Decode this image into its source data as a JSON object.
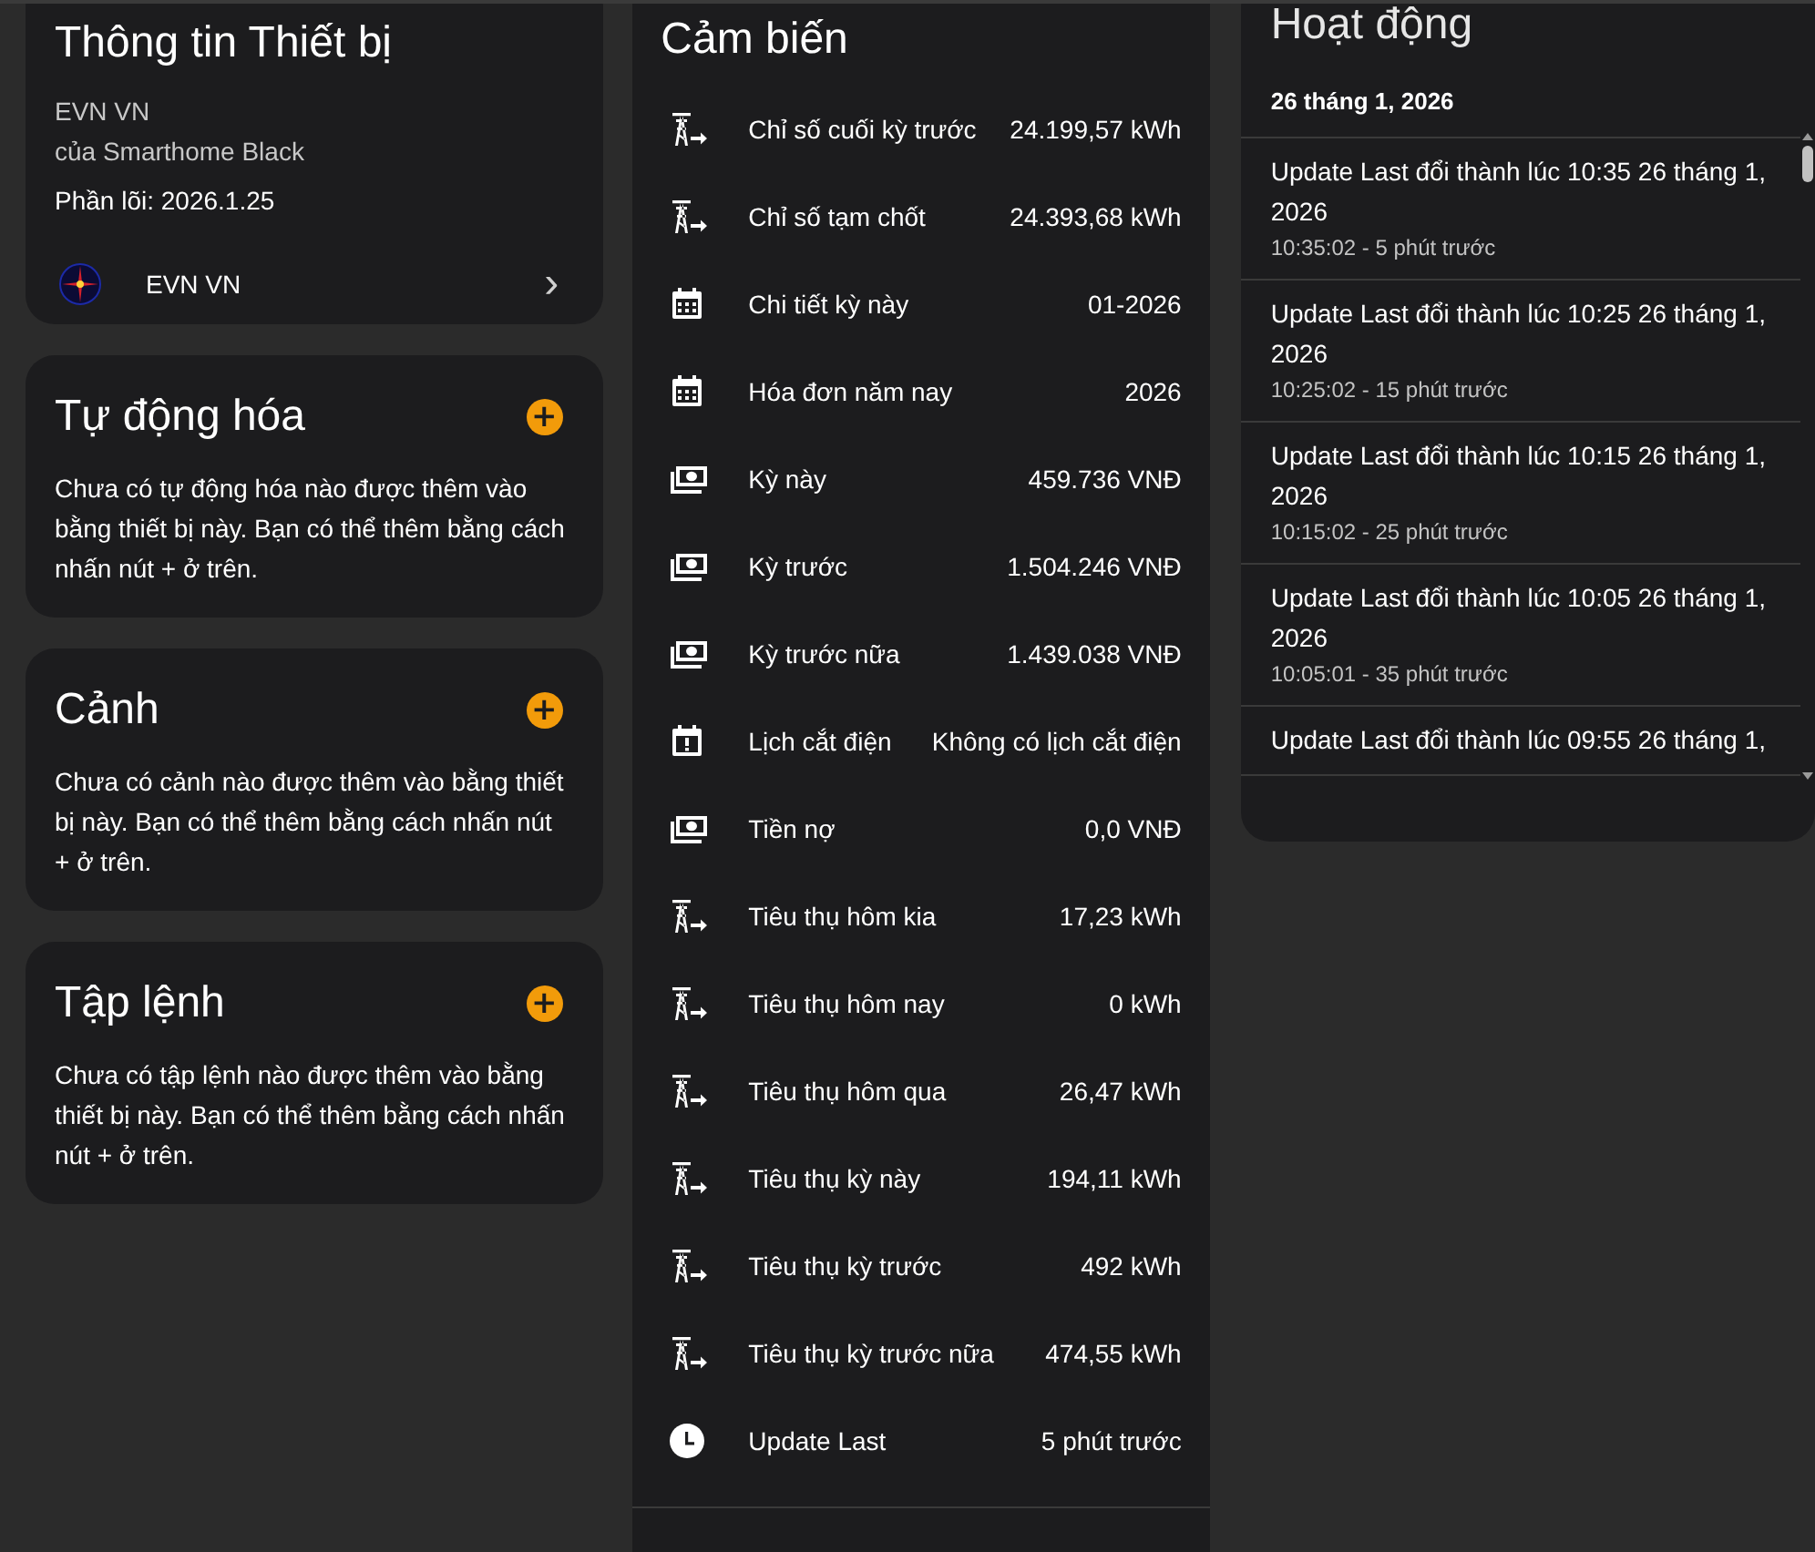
{
  "device_info": {
    "title": "Thông tin Thiết bị",
    "model": "EVN VN",
    "manufacturer": "của Smarthome Black",
    "firmware": "Phần lõi: 2026.1.25",
    "integration": {
      "name": "EVN VN",
      "chevron": "›"
    }
  },
  "sections": [
    {
      "title": "Tự động hóa",
      "add": "+",
      "empty_text": "Chưa có tự động hóa nào được thêm vào bằng thiết bị này. Bạn có thể thêm bằng cách nhấn nút + ở trên."
    },
    {
      "title": "Cảnh",
      "add": "+",
      "empty_text": "Chưa có cảnh nào được thêm vào bằng thiết bị này. Bạn có thể thêm bằng cách nhấn nút + ở trên."
    },
    {
      "title": "Tập lệnh",
      "add": "+",
      "empty_text": "Chưa có tập lệnh nào được thêm vào bằng thiết bị này. Bạn có thể thêm bằng cách nhấn nút + ở trên."
    }
  ],
  "sensors": {
    "title": "Cảm biến",
    "rows": [
      {
        "kind": "tower",
        "name": "Chỉ số cuối kỳ trước",
        "value": "24.199,57 kWh"
      },
      {
        "kind": "tower",
        "name": "Chỉ số tạm chốt",
        "value": "24.393,68 kWh"
      },
      {
        "kind": "calendar",
        "name": "Chi tiết kỳ này",
        "value": "01-2026"
      },
      {
        "kind": "calendar",
        "name": "Hóa đơn năm nay",
        "value": "2026"
      },
      {
        "kind": "cash",
        "name": "Kỳ này",
        "value": "459.736 VNĐ"
      },
      {
        "kind": "cash",
        "name": "Kỳ trước",
        "value": "1.504.246 VNĐ"
      },
      {
        "kind": "cash",
        "name": "Kỳ trước nữa",
        "value": "1.439.038 VNĐ"
      },
      {
        "kind": "alert",
        "name": "Lịch cắt điện",
        "value": "Không có lịch cắt điện"
      },
      {
        "kind": "cash",
        "name": "Tiền nợ",
        "value": "0,0 VNĐ"
      },
      {
        "kind": "tower",
        "name": "Tiêu thụ hôm kia",
        "value": "17,23 kWh"
      },
      {
        "kind": "tower",
        "name": "Tiêu thụ hôm nay",
        "value": "0 kWh"
      },
      {
        "kind": "tower",
        "name": "Tiêu thụ hôm qua",
        "value": "26,47 kWh"
      },
      {
        "kind": "tower",
        "name": "Tiêu thụ kỳ này",
        "value": "194,11 kWh"
      },
      {
        "kind": "tower",
        "name": "Tiêu thụ kỳ trước",
        "value": "492 kWh"
      },
      {
        "kind": "tower",
        "name": "Tiêu thụ kỳ trước nữa",
        "value": "474,55 kWh"
      },
      {
        "kind": "clock",
        "name": "Update Last",
        "value": "5 phút trước"
      }
    ]
  },
  "activity": {
    "title": "Hoạt động",
    "date": "26 tháng 1, 2026",
    "entries": [
      {
        "message": "Update Last đổi thành lúc 10:35 26 tháng 1, 2026",
        "time": "10:35:02 - 5 phút trước"
      },
      {
        "message": "Update Last đổi thành lúc 10:25 26 tháng 1, 2026",
        "time": "10:25:02 - 15 phút trước"
      },
      {
        "message": "Update Last đổi thành lúc 10:15 26 tháng 1, 2026",
        "time": "10:15:02 - 25 phút trước"
      },
      {
        "message": "Update Last đổi thành lúc 10:05 26 tháng 1, 2026",
        "time": "10:05:01 - 35 phút trước"
      },
      {
        "message": "Update Last đổi thành lúc 09:55 26 tháng 1,"
      }
    ]
  }
}
